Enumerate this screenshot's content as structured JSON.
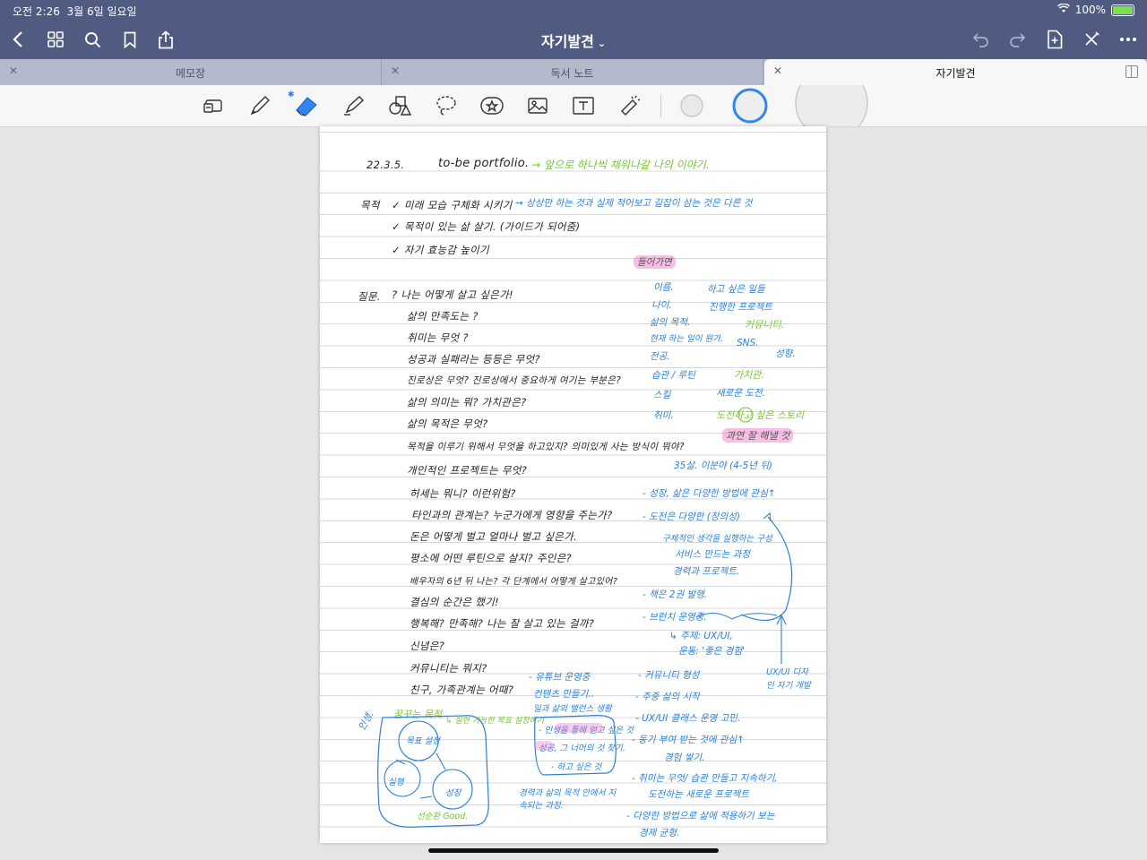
{
  "status_bar": {
    "time": "오전 2:26",
    "date": "3월 6일 일요일",
    "battery": "100%"
  },
  "nav": {
    "title": "자기발견",
    "icons": [
      "back-icon",
      "grid-icon",
      "search-icon",
      "bookmark-icon",
      "share-icon",
      "undo-icon",
      "redo-icon",
      "add-page-icon",
      "close-pen-icon",
      "more-icon"
    ]
  },
  "tabs": [
    {
      "label": "메모장",
      "active": false
    },
    {
      "label": "독서 노트",
      "active": false
    },
    {
      "label": "자기발견",
      "active": true
    }
  ],
  "toolbar": {
    "tools": [
      "zoom-box-icon",
      "pen-icon",
      "eraser-icon",
      "highlighter-icon",
      "shapes-icon",
      "lasso-icon",
      "sticker-icon",
      "image-icon",
      "text-icon",
      "laser-icon"
    ],
    "colors": {
      "accent": "#2f86f0",
      "header": "#4f5b80"
    }
  },
  "note": {
    "header_date": "22.3.5.",
    "header_title": "to-be portfolio.",
    "header_note": "→ 앞으로 하나씩 채워나갈 나의 이야기.",
    "purpose_label": "목적",
    "purpose": [
      "✓ 미래 모습 구체화 시키기",
      "✓ 목적이 있는 삶 살기. (가이드가 되어줌)",
      "✓ 자기 효능감 높이기"
    ],
    "purpose_note": "→ 상상만 하는 것과 실제 적어보고 길잡이 삼는 것은 다른 것",
    "question_label": "질문.",
    "questions": [
      "? 나는 어떻게 살고 싶은가!",
      "삶의 만족도는 ?",
      "취미는 무엇 ?",
      "성공과 실패라는 등등은 무엇?",
      "진로상은 무엇? 진로상에서 중요하게 여기는 부분은?",
      "삶의 의미는 뭐? 가치관은?",
      "삶의 목적은 무엇?",
      "목적을 이루기 위해서 무엇을 하고있지? 의미있게 사는 방식이 뭐야?",
      "개인적인 프로젝트는 무엇?",
      "허세는 뭐니? 이런위험?",
      "타인과의 관계는? 누군가에게 영향을 주는가?",
      "돈은 어떻게 벌고 얼마나 벌고 싶은가.",
      "평소에 어떤 루틴으로 살지? 주인은?",
      "배우자의 6년 뒤 나는? 각 단계에서 어떻게 살고있어?",
      "결심의 순간은 했기!",
      "행복해? 만족해? 나는 잘 살고 있는 걸까?",
      "신념은?",
      "커뮤니티는 뭐지?",
      "친구, 가족관계는 어때?"
    ],
    "discovery_label": "들어가면",
    "keywords_left": [
      "이름.",
      "나이.",
      "삶의 목적.",
      "현재 하는 일이 뭔가.",
      "전공.",
      "습관 / 루틴",
      "스킬",
      "취미."
    ],
    "keywords_right": [
      "하고 싶은 일들",
      "진행한 프로젝트",
      "커뮤니티.",
      "SNS.",
      "성향.",
      "가치관.",
      "새로운 도전.",
      "도전하고 싶은 스토리"
    ],
    "keywords_pink": "과연 잘 해낼 것",
    "age_note": "35살. 이분야 (4-5년 뒤)",
    "answers": [
      "- 성장, 삶은 다양한 방법에 관심↑",
      "- 도전은 다양한 (창의성)",
      "구체적인 생각을 실행하는 구성",
      "서비스 만드는 과정",
      "경력과 프로젝트.",
      "- 책은 2권 발행.",
      "- 브런치 운영중.",
      "↳ 주제: UX/UI,",
      "운동: '좋은 경험'",
      "- 유튜브 운영중",
      "컨텐츠 만들기..",
      "일과 삶의 밸런스 생활",
      "- 커뮤니티 형성",
      "- 주중 삶의 시작",
      "- UX/UI 클래스 운영 고민.",
      "- 동기 부여 받는 것에 관심↑",
      "경험 쌓기.",
      "- 취미는 무엇/ 습관 만들고 지속하기,",
      "도전하는 새로운 프로젝트",
      "- 다양한 방법으로 삶에 적용하기 보는",
      "경제 균형."
    ],
    "uxui_note": "UX/UI 디자인 자기 개발",
    "life_label": "인생.",
    "life_top": "꿈꾸는 목적",
    "cycle_nodes": [
      "목표 설정",
      "실행",
      "성장"
    ],
    "cycle_caption": "선순환 Good.",
    "cycle_side": "↳ 실현 가능한 목표 설정하기",
    "box_items": [
      "- 인생을 통해 얻고 싶은 것",
      "성공, 그 너머의 것 찾기.",
      "- 하고 싶은 것"
    ],
    "bottom_note": "경력과 삶의 목적 안에서 지속되는 과정."
  }
}
